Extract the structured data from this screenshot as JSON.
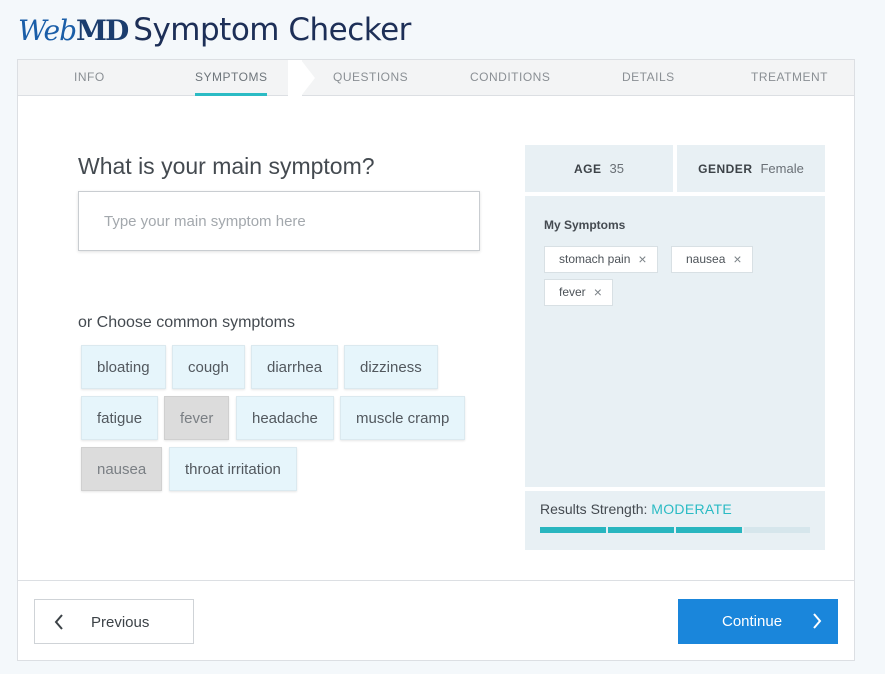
{
  "header": {
    "logo_web": "Web",
    "logo_md": "MD",
    "title": "Symptom Checker"
  },
  "steps": [
    {
      "label": "INFO"
    },
    {
      "label": "SYMPTOMS",
      "active": true
    },
    {
      "label": "QUESTIONS"
    },
    {
      "label": "CONDITIONS"
    },
    {
      "label": "DETAILS"
    },
    {
      "label": "TREATMENT"
    }
  ],
  "main": {
    "question": "What is your main symptom?",
    "input_placeholder": "Type your main symptom here",
    "input_value": "",
    "common_label": "or Choose common symptoms",
    "chips": [
      {
        "label": "bloating",
        "selected": false
      },
      {
        "label": "cough",
        "selected": false
      },
      {
        "label": "diarrhea",
        "selected": false
      },
      {
        "label": "dizziness",
        "selected": false
      },
      {
        "label": "fatigue",
        "selected": false
      },
      {
        "label": "fever",
        "selected": true
      },
      {
        "label": "headache",
        "selected": false
      },
      {
        "label": "muscle cramp",
        "selected": false
      },
      {
        "label": "nausea",
        "selected": true
      },
      {
        "label": "throat irritation",
        "selected": false
      }
    ]
  },
  "panel": {
    "age_label": "AGE",
    "age_value": "35",
    "gender_label": "GENDER",
    "gender_value": "Female",
    "my_symptoms_title": "My Symptoms",
    "symptoms": [
      {
        "label": "stomach pain",
        "remove": "×"
      },
      {
        "label": "nausea",
        "remove": "×"
      },
      {
        "label": "fever",
        "remove": "×"
      }
    ],
    "strength_label": "Results Strength:",
    "strength_value": "MODERATE",
    "strength_filled": 3,
    "strength_total": 4
  },
  "footer": {
    "previous_label": "Previous",
    "continue_label": "Continue"
  },
  "colors": {
    "accent": "#2bbbc4",
    "primary_button": "#1a86db",
    "chip_bg": "#e6f5fb",
    "chip_selected_bg": "#dcdcdc"
  },
  "icons": {
    "previous": "chevron-left-icon",
    "continue": "chevron-right-icon",
    "remove": "close-icon"
  }
}
